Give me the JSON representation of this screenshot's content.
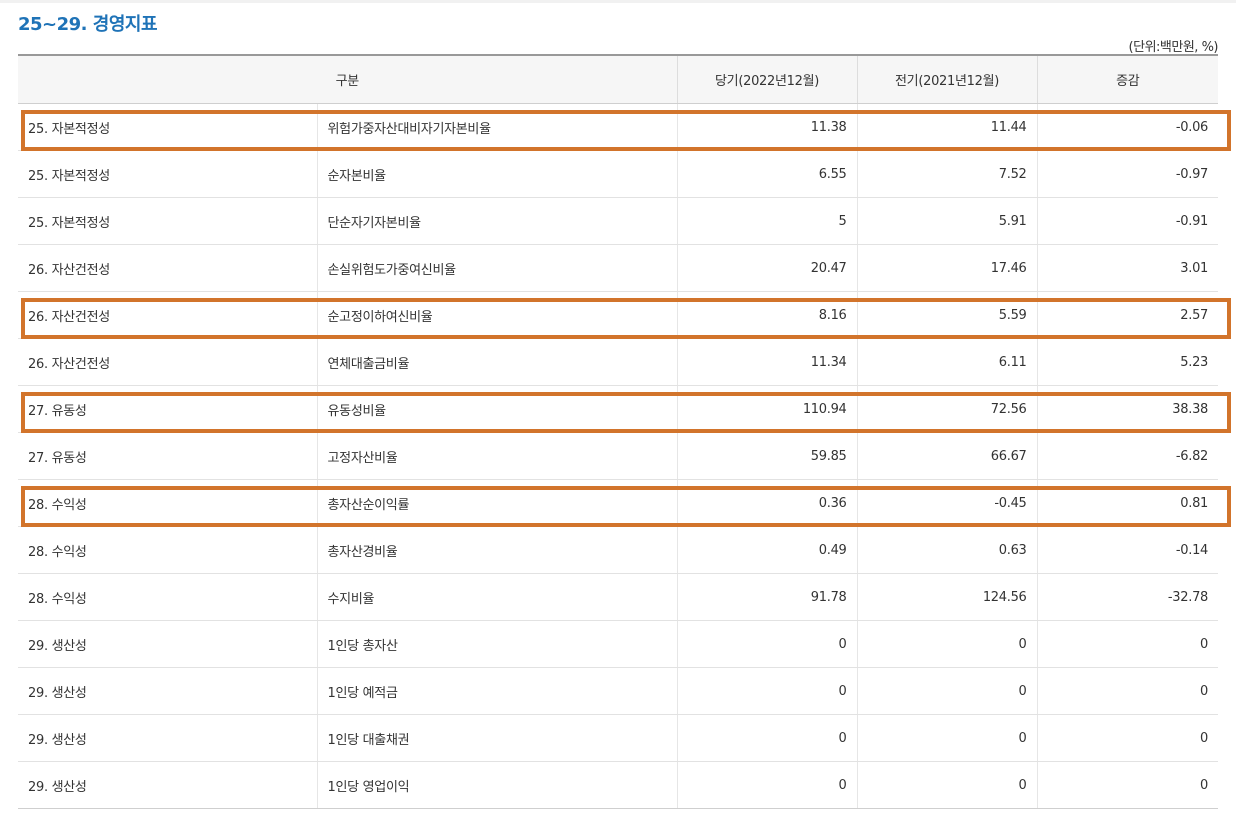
{
  "title": "25~29. 경영지표",
  "unit": "(단위:백만원, %)",
  "columns": {
    "category": "구분",
    "current": "당기(2022년12월)",
    "previous": "전기(2021년12월)",
    "change": "증감"
  },
  "rows": [
    {
      "group": "25. 자본적정성",
      "item": "위험가중자산대비자기자본비율",
      "current": "11.38",
      "previous": "11.44",
      "change": "-0.06",
      "highlighted": true
    },
    {
      "group": "25. 자본적정성",
      "item": "순자본비율",
      "current": "6.55",
      "previous": "7.52",
      "change": "-0.97",
      "highlighted": false
    },
    {
      "group": "25. 자본적정성",
      "item": "단순자기자본비율",
      "current": "5",
      "previous": "5.91",
      "change": "-0.91",
      "highlighted": false
    },
    {
      "group": "26. 자산건전성",
      "item": "손실위험도가중여신비율",
      "current": "20.47",
      "previous": "17.46",
      "change": "3.01",
      "highlighted": false
    },
    {
      "group": "26. 자산건전성",
      "item": "순고정이하여신비율",
      "current": "8.16",
      "previous": "5.59",
      "change": "2.57",
      "highlighted": true
    },
    {
      "group": "26. 자산건전성",
      "item": "연체대출금비율",
      "current": "11.34",
      "previous": "6.11",
      "change": "5.23",
      "highlighted": false
    },
    {
      "group": "27. 유동성",
      "item": "유동성비율",
      "current": "110.94",
      "previous": "72.56",
      "change": "38.38",
      "highlighted": true
    },
    {
      "group": "27. 유동성",
      "item": "고정자산비율",
      "current": "59.85",
      "previous": "66.67",
      "change": "-6.82",
      "highlighted": false
    },
    {
      "group": "28. 수익성",
      "item": "총자산순이익률",
      "current": "0.36",
      "previous": "-0.45",
      "change": "0.81",
      "highlighted": true
    },
    {
      "group": "28. 수익성",
      "item": "총자산경비율",
      "current": "0.49",
      "previous": "0.63",
      "change": "-0.14",
      "highlighted": false
    },
    {
      "group": "28. 수익성",
      "item": "수지비율",
      "current": "91.78",
      "previous": "124.56",
      "change": "-32.78",
      "highlighted": false
    },
    {
      "group": "29. 생산성",
      "item": "1인당 총자산",
      "current": "0",
      "previous": "0",
      "change": "0",
      "highlighted": false
    },
    {
      "group": "29. 생산성",
      "item": "1인당 예적금",
      "current": "0",
      "previous": "0",
      "change": "0",
      "highlighted": false
    },
    {
      "group": "29. 생산성",
      "item": "1인당 대출채권",
      "current": "0",
      "previous": "0",
      "change": "0",
      "highlighted": false
    },
    {
      "group": "29. 생산성",
      "item": "1인당 영업이익",
      "current": "0",
      "previous": "0",
      "change": "0",
      "highlighted": false
    }
  ],
  "colors": {
    "title": "#1f73b7",
    "highlight_border": "#d2742b",
    "header_bg": "#f6f6f6"
  }
}
